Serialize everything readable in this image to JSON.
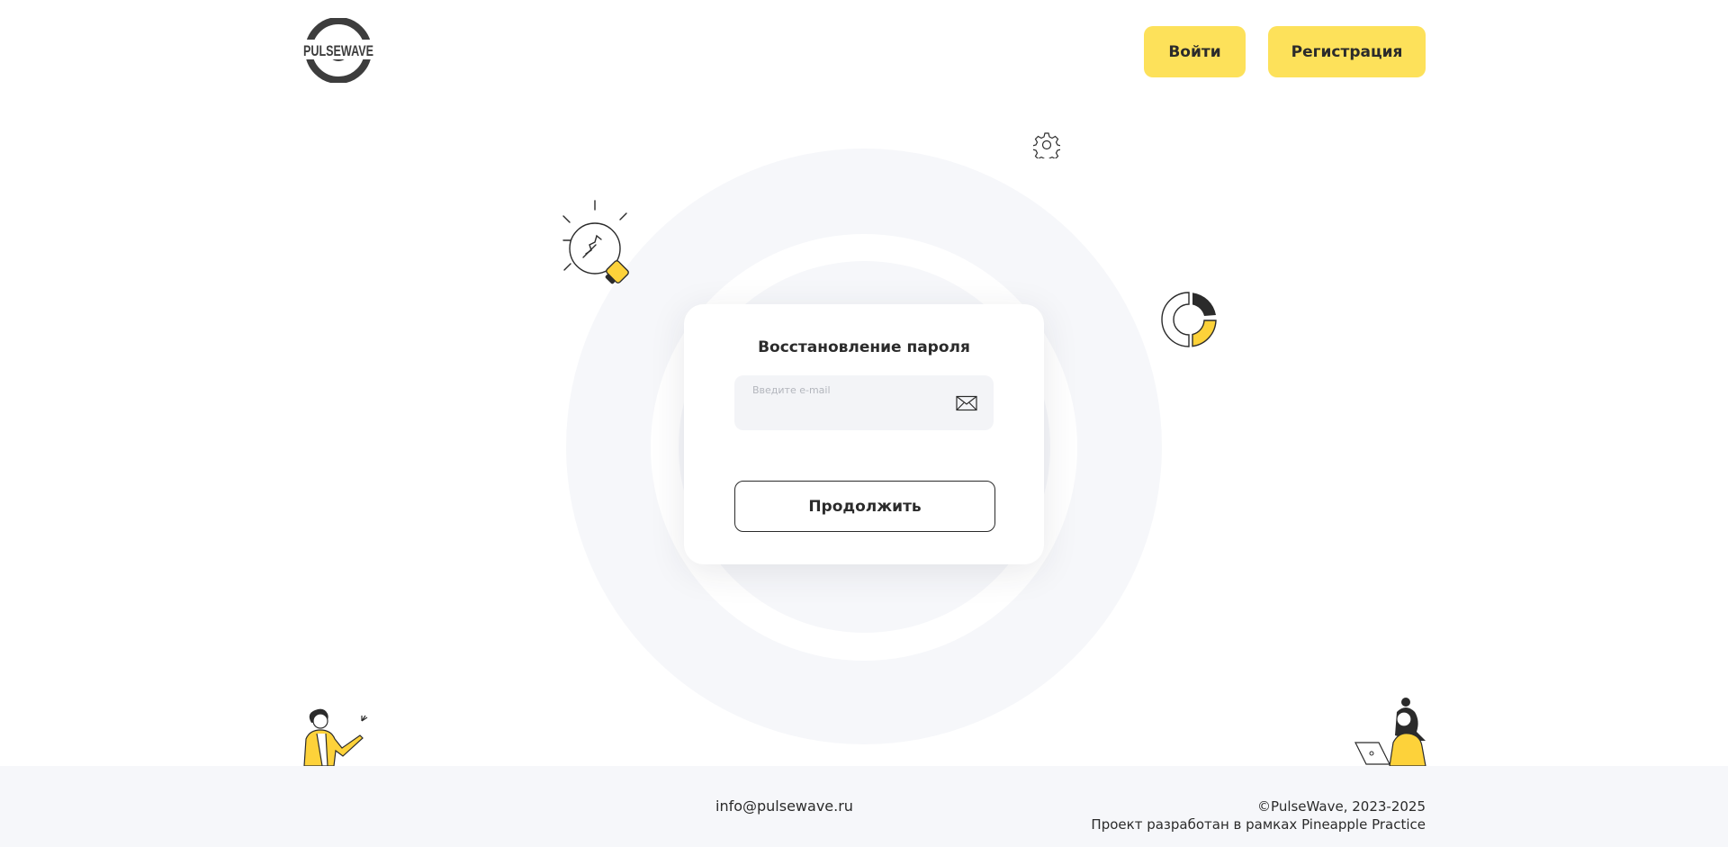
{
  "header": {
    "logo_text": "PULSEWAVE",
    "login_label": "Войти",
    "register_label": "Регистрация"
  },
  "recovery_form": {
    "title": "Восстановление пароля",
    "email_label": "Введите e-mail",
    "email_value": "",
    "continue_label": "Продолжить"
  },
  "footer": {
    "email": "info@pulsewave.ru",
    "copyright": "©PulseWave, 2023-2025",
    "project_note": "Проект разработан в рамках Pineapple Practice"
  },
  "colors": {
    "accent_yellow": "#fde15a",
    "text_dark": "#2b2b2b",
    "background_light": "#f6f7fa"
  },
  "icons": {
    "email_field": "envelope-icon",
    "decorations": [
      "lightbulb-icon",
      "gear-icon",
      "donut-chart-icon",
      "man-waving-illustration",
      "woman-laptop-illustration"
    ]
  }
}
